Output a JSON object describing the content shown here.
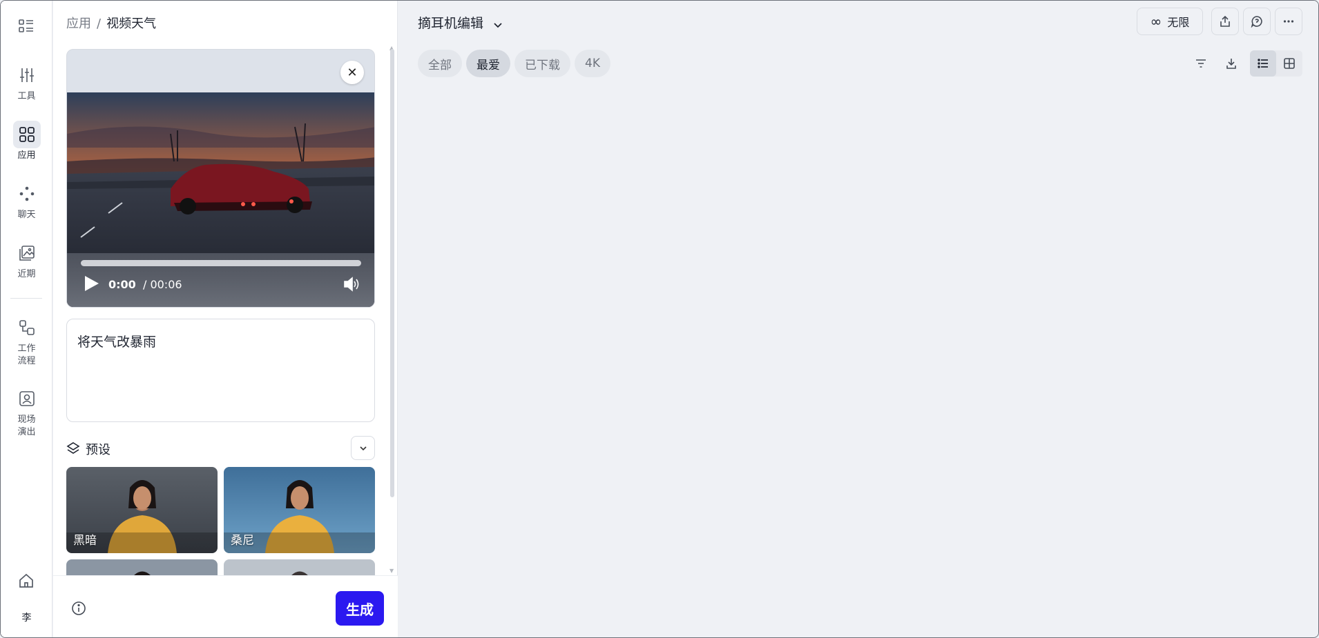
{
  "breadcrumb": {
    "root": "应用",
    "separator": "/",
    "current": "视频天气"
  },
  "rail": {
    "items": [
      {
        "label": "工具",
        "icon": "sliders-icon"
      },
      {
        "label": "应用",
        "icon": "grid-icon",
        "active": true
      },
      {
        "label": "聊天",
        "icon": "dots-icon"
      },
      {
        "label": "近期",
        "icon": "gallery-icon"
      },
      {
        "label": "工作\n流程",
        "icon": "workflow-icon"
      },
      {
        "label": "现场\n演出",
        "icon": "live-icon"
      }
    ],
    "user_initial": "李"
  },
  "video": {
    "current_time": "0:00",
    "duration": "/ 00:06",
    "progress": 0.0
  },
  "prompt": {
    "text": "将天气改暴雨"
  },
  "presets": {
    "title": "预设",
    "items": [
      {
        "label": "黑暗"
      },
      {
        "label": "桑尼"
      }
    ]
  },
  "footer": {
    "generate_label": "生成"
  },
  "main": {
    "project_title": "摘耳机编辑",
    "unlimited_label": "无限",
    "tabs": [
      {
        "label": "全部",
        "active": false
      },
      {
        "label": "最爱",
        "active": true
      },
      {
        "label": "已下载",
        "active": false
      },
      {
        "label": "4K",
        "active": false
      }
    ],
    "view_mode": "list"
  },
  "colors": {
    "accent": "#2b19f0",
    "panel_bg": "#ffffff",
    "main_bg": "#eff1f5"
  }
}
